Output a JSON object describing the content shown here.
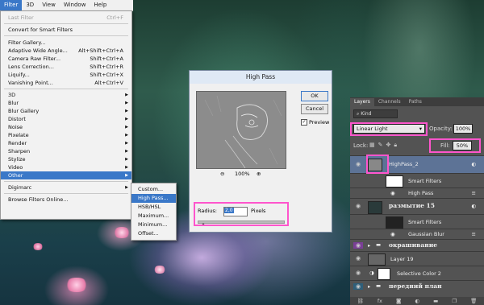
{
  "menubar": {
    "items": [
      "Filter",
      "3D",
      "View",
      "Window",
      "Help"
    ]
  },
  "filter_menu": {
    "items": [
      {
        "label": "Last Filter",
        "shortcut": "Ctrl+F",
        "disabled": true
      },
      {
        "label": "Convert for Smart Filters"
      },
      {
        "label": "Filter Gallery..."
      },
      {
        "label": "Adaptive Wide Angle...",
        "shortcut": "Alt+Shift+Ctrl+A"
      },
      {
        "label": "Camera Raw Filter...",
        "shortcut": "Shift+Ctrl+A"
      },
      {
        "label": "Lens Correction...",
        "shortcut": "Shift+Ctrl+R"
      },
      {
        "label": "Liquify...",
        "shortcut": "Shift+Ctrl+X"
      },
      {
        "label": "Vanishing Point...",
        "shortcut": "Alt+Ctrl+V"
      },
      {
        "label": "3D",
        "submenu": true
      },
      {
        "label": "Blur",
        "submenu": true
      },
      {
        "label": "Blur Gallery",
        "submenu": true
      },
      {
        "label": "Distort",
        "submenu": true
      },
      {
        "label": "Noise",
        "submenu": true
      },
      {
        "label": "Pixelate",
        "submenu": true
      },
      {
        "label": "Render",
        "submenu": true
      },
      {
        "label": "Sharpen",
        "submenu": true
      },
      {
        "label": "Stylize",
        "submenu": true
      },
      {
        "label": "Video",
        "submenu": true
      },
      {
        "label": "Other",
        "submenu": true,
        "highlighted": true
      },
      {
        "label": "Digimarc",
        "submenu": true
      },
      {
        "label": "Browse Filters Online..."
      }
    ]
  },
  "other_submenu": {
    "items": [
      "Custom...",
      "High Pass...",
      "HSB/HSL",
      "Maximum...",
      "Minimum...",
      "Offset..."
    ],
    "highlighted_index": 1
  },
  "dialog": {
    "title": "High Pass",
    "ok": "OK",
    "cancel": "Cancel",
    "preview_label": "Preview",
    "preview_checked": true,
    "zoom": "100%",
    "radius_label": "Radius:",
    "radius_value": "2,0",
    "unit": "Pixels"
  },
  "layers_panel": {
    "tabs": [
      "Layers",
      "Channels",
      "Paths"
    ],
    "kind_label": "Kind",
    "blend_mode": "Linear Light",
    "opacity_label": "Opacity:",
    "opacity_value": "100%",
    "lock_label": "Lock:",
    "fill_label": "Fill:",
    "fill_value": "50%",
    "layers": [
      {
        "name": "HighPass_2",
        "selected": true
      },
      {
        "name": "Smart Filters"
      },
      {
        "name": "High Pass"
      },
      {
        "name": "размытие 15"
      },
      {
        "name": "Smart Filters"
      },
      {
        "name": "Gaussian Blur"
      },
      {
        "name": "окрашивание"
      },
      {
        "name": "Layer 19"
      },
      {
        "name": "Selective Color 2"
      },
      {
        "name": "передний план"
      }
    ],
    "bottom_icons": [
      "link-icon",
      "fx-icon",
      "mask-icon",
      "adjustment-icon",
      "folder-icon",
      "new-layer-icon",
      "trash-icon"
    ]
  },
  "colors": {
    "highlight": "#3a78c8",
    "annotation": "#ff55cc",
    "panel_bg": "#535353"
  }
}
